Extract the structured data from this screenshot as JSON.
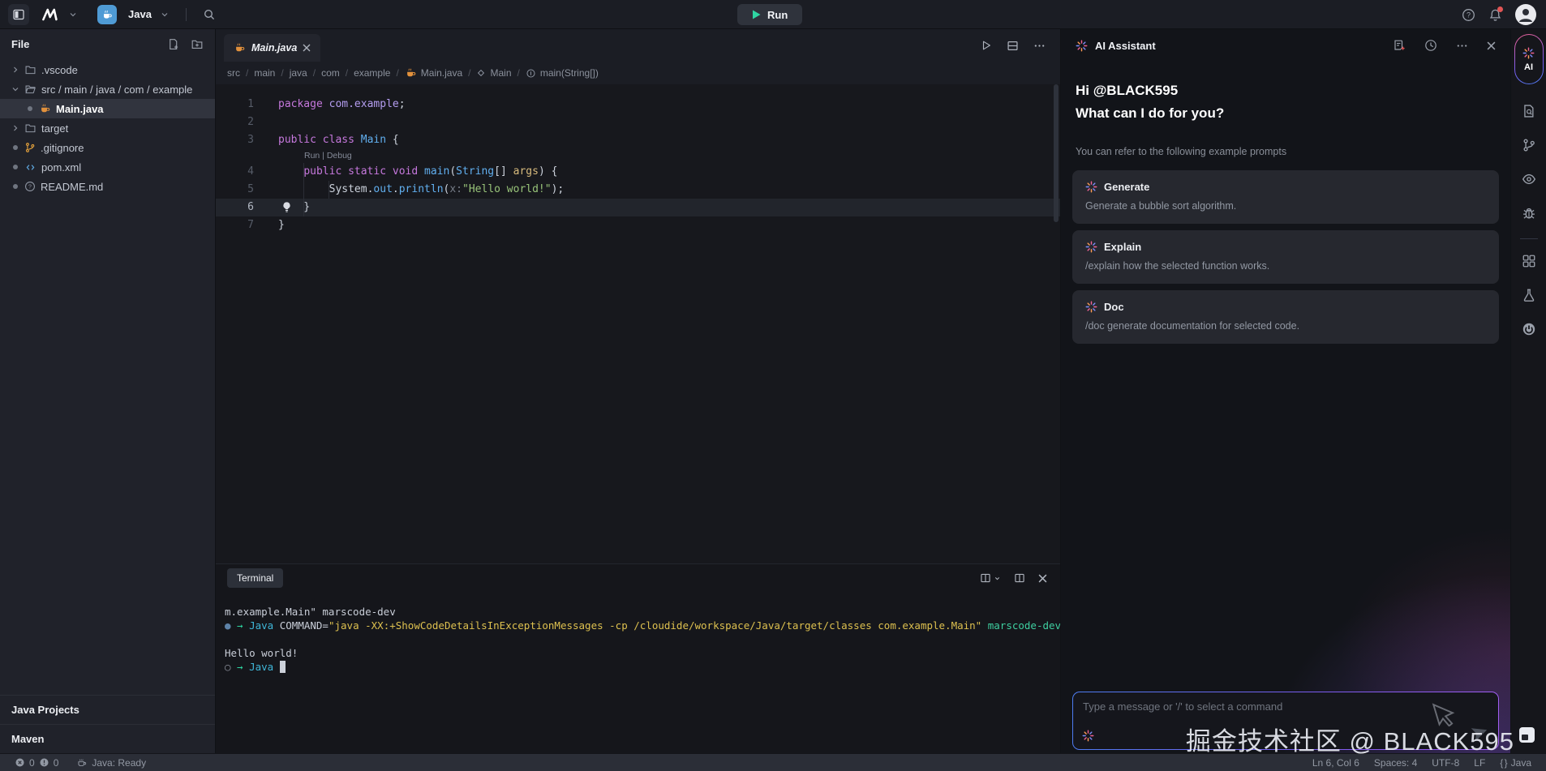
{
  "topbar": {
    "workspace_label": "Java",
    "run_label": "Run"
  },
  "sidebar": {
    "header": "File",
    "tree": [
      {
        "icon": "folder",
        "chevron": "right",
        "indent": 0,
        "dot": false,
        "selected": false,
        "label": ".vscode"
      },
      {
        "icon": "folder-open",
        "chevron": "down",
        "indent": 0,
        "dot": false,
        "selected": false,
        "label": "src / main / java / com / example"
      },
      {
        "icon": "java",
        "chevron": "none",
        "indent": 1,
        "dot": true,
        "selected": true,
        "label": "Main.java"
      },
      {
        "icon": "folder",
        "chevron": "right",
        "indent": 0,
        "dot": false,
        "selected": false,
        "label": "target"
      },
      {
        "icon": "git",
        "chevron": "none",
        "indent": 0,
        "dot": true,
        "selected": false,
        "label": ".gitignore"
      },
      {
        "icon": "code",
        "chevron": "none",
        "indent": 0,
        "dot": true,
        "selected": false,
        "label": "pom.xml"
      },
      {
        "icon": "readme",
        "chevron": "none",
        "indent": 0,
        "dot": true,
        "selected": false,
        "label": "README.md"
      }
    ],
    "sections": [
      {
        "label": "Java Projects"
      },
      {
        "label": "Maven"
      }
    ]
  },
  "editor": {
    "tab": {
      "title": "Main.java"
    },
    "breadcrumbs": [
      {
        "label": "src"
      },
      {
        "label": "main"
      },
      {
        "label": "java"
      },
      {
        "label": "com"
      },
      {
        "label": "example"
      },
      {
        "label": "Main.java",
        "icon": "java"
      },
      {
        "label": "Main",
        "icon": "symbol-class"
      },
      {
        "label": "main(String[])",
        "icon": "symbol-method"
      }
    ],
    "codelens": {
      "run": "Run",
      "sep": " | ",
      "debug": "Debug"
    },
    "lines": [
      {
        "n": "1",
        "tokens": [
          {
            "t": "package ",
            "c": "kw"
          },
          {
            "t": "com.example",
            "c": "pkg"
          },
          {
            "t": ";",
            "c": "pln"
          }
        ]
      },
      {
        "n": "2",
        "tokens": []
      },
      {
        "n": "3",
        "tokens": [
          {
            "t": "public class ",
            "c": "kw"
          },
          {
            "t": "Main",
            "c": "typ"
          },
          {
            "t": " {",
            "c": "pln"
          }
        ]
      },
      {
        "n": "4",
        "lens": true,
        "guides": [
          1
        ],
        "tokens": [
          {
            "t": "    ",
            "c": "pln"
          },
          {
            "t": "public static void ",
            "c": "kw"
          },
          {
            "t": "main",
            "c": "fn"
          },
          {
            "t": "(",
            "c": "pln"
          },
          {
            "t": "String",
            "c": "typ"
          },
          {
            "t": "[] ",
            "c": "pln"
          },
          {
            "t": "args",
            "c": "arg"
          },
          {
            "t": ") {",
            "c": "pln"
          }
        ]
      },
      {
        "n": "5",
        "guides": [
          1,
          2
        ],
        "tokens": [
          {
            "t": "        ",
            "c": "pln"
          },
          {
            "t": "System",
            "c": "pln"
          },
          {
            "t": ".",
            "c": "pln"
          },
          {
            "t": "out",
            "c": "fn"
          },
          {
            "t": ".",
            "c": "pln"
          },
          {
            "t": "println",
            "c": "fn"
          },
          {
            "t": "(",
            "c": "pln"
          },
          {
            "t": "x:",
            "c": "hint"
          },
          {
            "t": "\"Hello world!\"",
            "c": "str"
          },
          {
            "t": ");",
            "c": "pln"
          }
        ]
      },
      {
        "n": "6",
        "current": true,
        "bulb": true,
        "guides": [
          1
        ],
        "tokens": [
          {
            "t": "    }",
            "c": "pln"
          }
        ]
      },
      {
        "n": "7",
        "tokens": [
          {
            "t": "}",
            "c": "pln"
          }
        ]
      }
    ]
  },
  "terminal": {
    "tab_label": "Terminal",
    "lines": [
      {
        "tokens": [
          {
            "t": "m.example.Main\" marscode-dev",
            "c": "pln"
          }
        ]
      },
      {
        "tokens": [
          {
            "t": "●",
            "c": "dot"
          },
          {
            "t": " → ",
            "c": "arr"
          },
          {
            "t": "Java ",
            "c": "cy"
          },
          {
            "t": "COMMAND=",
            "c": "pln"
          },
          {
            "t": "\"java -XX:+ShowCodeDetailsInExceptionMessages -cp /cloudide/workspace/Java/target/classes com.example.Main\"",
            "c": "yel"
          },
          {
            "t": " marscode-dev",
            "c": "tea"
          }
        ]
      },
      {
        "tokens": []
      },
      {
        "tokens": [
          {
            "t": "Hello world!",
            "c": "pln"
          }
        ]
      },
      {
        "tokens": [
          {
            "t": "○",
            "c": "cir"
          },
          {
            "t": " → ",
            "c": "arr"
          },
          {
            "t": "Java ",
            "c": "cy"
          },
          {
            "t": "█",
            "c": "cur"
          }
        ]
      }
    ]
  },
  "ai": {
    "title": "AI Assistant",
    "activity_label": "AI",
    "greeting1": "Hi @BLACK595",
    "greeting2": "What can I do for you?",
    "hint": "You can refer to the following example prompts",
    "cards": [
      {
        "title": "Generate",
        "desc": "Generate a bubble sort algorithm."
      },
      {
        "title": "Explain",
        "desc": "/explain how the selected function works."
      },
      {
        "title": "Doc",
        "desc": "/doc generate documentation for selected code."
      }
    ],
    "input_placeholder": "Type a message or '/' to select a command"
  },
  "statusbar": {
    "errors": "0",
    "warnings": "0",
    "java_status": "Java: Ready",
    "cursor": "Ln 6, Col 6",
    "spaces": "Spaces: 4",
    "encoding": "UTF-8",
    "eol": "LF",
    "braces": "{ }",
    "language": "Java"
  },
  "watermark": {
    "text": "掘金技术社区 @ BLACK595"
  }
}
